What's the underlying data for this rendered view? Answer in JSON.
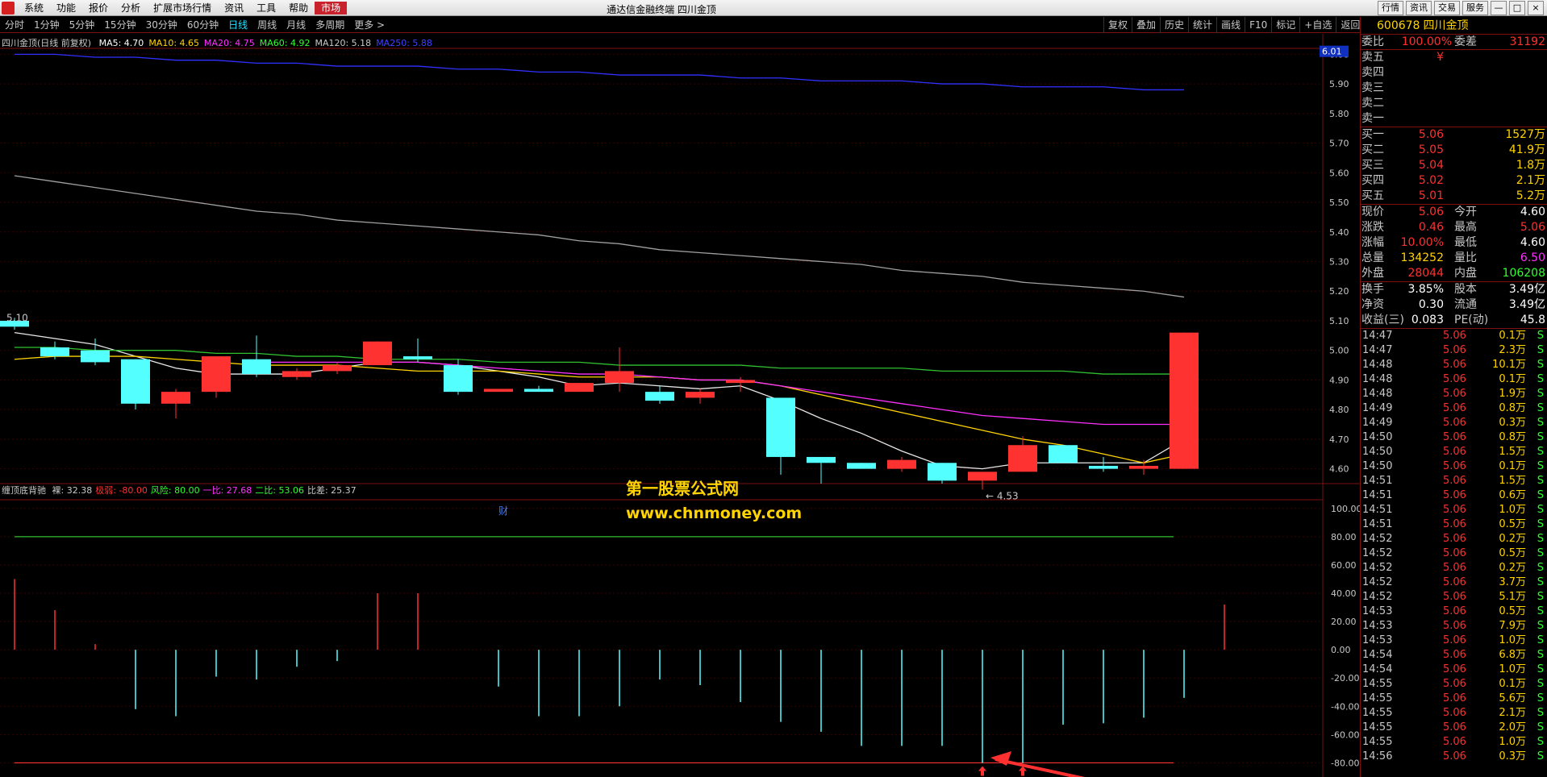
{
  "app": {
    "title": "通达信金融终端 四川金顶",
    "menus": [
      "系统",
      "功能",
      "报价",
      "分析",
      "扩展市场行情",
      "资讯",
      "工具",
      "帮助",
      "市场"
    ],
    "active_menu": "市场",
    "window_buttons": [
      "行情",
      "资讯",
      "交易",
      "服务"
    ]
  },
  "period_tabs": [
    "分时",
    "1分钟",
    "5分钟",
    "15分钟",
    "30分钟",
    "60分钟",
    "日线",
    "周线",
    "月线",
    "多周期",
    "更多 >"
  ],
  "active_period": "日线",
  "right_tools": [
    "复权",
    "叠加",
    "历史",
    "统计",
    "画线",
    "F10",
    "标记",
    "+自选",
    "返回"
  ],
  "info": {
    "stock": "四川金顶(日线 前复权)",
    "ma": [
      {
        "label": "MA5: 4.70",
        "color": "#ffffff"
      },
      {
        "label": "MA10: 4.65",
        "color": "#ffd400"
      },
      {
        "label": "MA20: 4.75",
        "color": "#ff30ff"
      },
      {
        "label": "MA60: 4.92",
        "color": "#30ff30"
      },
      {
        "label": "MA120: 5.18",
        "color": "#c8c8c8"
      },
      {
        "label": "MA250: 5.88",
        "color": "#4040ff"
      }
    ]
  },
  "chart_data": {
    "type": "candlestick",
    "price_axis": {
      "ticks": [
        "6.00",
        "5.90",
        "5.80",
        "5.70",
        "5.60",
        "5.50",
        "5.40",
        "5.30",
        "5.20",
        "5.10",
        "5.00",
        "4.90",
        "4.80",
        "4.70",
        "4.60"
      ],
      "min": 4.55,
      "max": 6.02,
      "current_label": "6.01"
    },
    "candles": [
      {
        "o": 5.1,
        "h": 5.11,
        "l": 5.07,
        "c": 5.08
      },
      {
        "o": 5.01,
        "h": 5.03,
        "l": 4.97,
        "c": 4.98
      },
      {
        "o": 5.0,
        "h": 5.04,
        "l": 4.95,
        "c": 4.96
      },
      {
        "o": 4.97,
        "h": 4.97,
        "l": 4.8,
        "c": 4.82
      },
      {
        "o": 4.82,
        "h": 4.87,
        "l": 4.77,
        "c": 4.86
      },
      {
        "o": 4.86,
        "h": 4.98,
        "l": 4.84,
        "c": 4.98
      },
      {
        "o": 4.97,
        "h": 5.05,
        "l": 4.91,
        "c": 4.92
      },
      {
        "o": 4.91,
        "h": 4.94,
        "l": 4.9,
        "c": 4.93
      },
      {
        "o": 4.93,
        "h": 4.96,
        "l": 4.92,
        "c": 4.95
      },
      {
        "o": 4.95,
        "h": 5.03,
        "l": 4.95,
        "c": 5.03
      },
      {
        "o": 4.98,
        "h": 5.04,
        "l": 4.96,
        "c": 4.97
      },
      {
        "o": 4.95,
        "h": 4.97,
        "l": 4.85,
        "c": 4.86
      },
      {
        "o": 4.86,
        "h": 4.86,
        "l": 4.86,
        "c": 4.87
      },
      {
        "o": 4.87,
        "h": 4.88,
        "l": 4.86,
        "c": 4.86
      },
      {
        "o": 4.86,
        "h": 4.89,
        "l": 4.86,
        "c": 4.89
      },
      {
        "o": 4.89,
        "h": 5.01,
        "l": 4.86,
        "c": 4.93
      },
      {
        "o": 4.86,
        "h": 4.88,
        "l": 4.82,
        "c": 4.83
      },
      {
        "o": 4.84,
        "h": 4.87,
        "l": 4.82,
        "c": 4.86
      },
      {
        "o": 4.89,
        "h": 4.91,
        "l": 4.86,
        "c": 4.9
      },
      {
        "o": 4.84,
        "h": 4.84,
        "l": 4.58,
        "c": 4.64
      },
      {
        "o": 4.64,
        "h": 4.64,
        "l": 4.55,
        "c": 4.62
      },
      {
        "o": 4.62,
        "h": 4.62,
        "l": 4.6,
        "c": 4.6
      },
      {
        "o": 4.6,
        "h": 4.64,
        "l": 4.59,
        "c": 4.63
      },
      {
        "o": 4.62,
        "h": 4.62,
        "l": 4.55,
        "c": 4.56
      },
      {
        "o": 4.56,
        "h": 4.58,
        "l": 4.53,
        "c": 4.59
      },
      {
        "o": 4.59,
        "h": 4.71,
        "l": 4.59,
        "c": 4.68
      },
      {
        "o": 4.68,
        "h": 4.68,
        "l": 4.62,
        "c": 4.62
      },
      {
        "o": 4.61,
        "h": 4.64,
        "l": 4.59,
        "c": 4.6
      },
      {
        "o": 4.6,
        "h": 4.63,
        "l": 4.58,
        "c": 4.61
      },
      {
        "o": 4.6,
        "h": 5.06,
        "l": 4.6,
        "c": 5.06
      }
    ],
    "ma_lines": [
      {
        "name": "MA5",
        "color": "#e8e8e8",
        "values": [
          5.06,
          5.04,
          5.02,
          4.98,
          4.94,
          4.92,
          4.92,
          4.92,
          4.94,
          4.96,
          4.96,
          4.95,
          4.93,
          4.91,
          4.88,
          4.89,
          4.88,
          4.87,
          4.88,
          4.83,
          4.77,
          4.72,
          4.66,
          4.61,
          4.6,
          4.62,
          4.62,
          4.62,
          4.62,
          4.7
        ]
      },
      {
        "name": "MA10",
        "color": "#ffd400",
        "values": [
          4.97,
          4.98,
          4.98,
          4.98,
          4.97,
          4.96,
          4.95,
          4.95,
          4.95,
          4.94,
          4.93,
          4.93,
          4.93,
          4.92,
          4.91,
          4.91,
          4.91,
          4.9,
          4.9,
          4.88,
          4.85,
          4.82,
          4.79,
          4.76,
          4.73,
          4.7,
          4.68,
          4.65,
          4.62,
          4.65
        ]
      },
      {
        "name": "MA20",
        "color": "#ff30ff",
        "values": [
          null,
          null,
          null,
          null,
          null,
          null,
          4.96,
          4.96,
          4.96,
          4.96,
          4.96,
          4.95,
          4.94,
          4.93,
          4.92,
          4.92,
          4.91,
          4.9,
          4.9,
          4.88,
          4.86,
          4.84,
          4.82,
          4.8,
          4.78,
          4.77,
          4.76,
          4.75,
          4.75,
          4.75
        ]
      },
      {
        "name": "MA60",
        "color": "#30c030",
        "values": [
          5.01,
          5.01,
          5.0,
          5.0,
          5.0,
          4.99,
          4.99,
          4.98,
          4.98,
          4.97,
          4.97,
          4.97,
          4.96,
          4.96,
          4.96,
          4.95,
          4.95,
          4.95,
          4.95,
          4.94,
          4.94,
          4.94,
          4.94,
          4.93,
          4.93,
          4.93,
          4.93,
          4.92,
          4.92,
          4.92
        ]
      },
      {
        "name": "MA120",
        "color": "#a0a0a0",
        "values": [
          5.59,
          5.57,
          5.55,
          5.53,
          5.51,
          5.49,
          5.47,
          5.46,
          5.44,
          5.43,
          5.42,
          5.41,
          5.4,
          5.39,
          5.37,
          5.36,
          5.34,
          5.33,
          5.32,
          5.31,
          5.3,
          5.29,
          5.27,
          5.26,
          5.25,
          5.23,
          5.22,
          5.21,
          5.2,
          5.18
        ]
      },
      {
        "name": "MA250",
        "color": "#3030ff",
        "values": [
          6.0,
          6.0,
          5.99,
          5.99,
          5.98,
          5.98,
          5.97,
          5.97,
          5.96,
          5.96,
          5.96,
          5.95,
          5.95,
          5.94,
          5.94,
          5.93,
          5.93,
          5.93,
          5.92,
          5.92,
          5.91,
          5.91,
          5.91,
          5.9,
          5.9,
          5.89,
          5.89,
          5.89,
          5.88,
          5.88
        ]
      }
    ],
    "annotations": [
      {
        "text": "5.10",
        "candle": 0
      },
      {
        "text": "← 4.53",
        "candle": 24
      },
      {
        "text": "财",
        "candle": 12
      }
    ],
    "indicator": {
      "name": "缠顶底背驰",
      "params": [
        {
          "label": "裸: 32.38",
          "color": "#c8c8c8"
        },
        {
          "label": "极弱: -80.00",
          "color": "#ff3030"
        },
        {
          "label": "风险: 80.00",
          "color": "#30ff30"
        },
        {
          "label": "一比: 27.68",
          "color": "#ff30ff"
        },
        {
          "label": "二比: 53.06",
          "color": "#30ff30"
        },
        {
          "label": "比差: 25.37",
          "color": "#c8c8c8"
        }
      ],
      "axis": {
        "ticks": [
          "100.00",
          "80.00",
          "60.00",
          "40.00",
          "20.00",
          "0.00",
          "-20.00",
          "-40.00",
          "-60.00",
          "-80.00"
        ],
        "min": -90,
        "max": 105
      },
      "values": [
        50,
        28,
        4,
        -42,
        -47,
        -19,
        -21,
        -12,
        -8,
        40,
        40,
        0,
        -26,
        -47,
        -47,
        -40,
        -21,
        -25,
        -37,
        -51,
        -58,
        -68,
        -68,
        -68,
        -80,
        -80,
        -53,
        -52,
        -48,
        -34,
        32
      ]
    }
  },
  "watermark": {
    "line1": "第一股票公式网",
    "line2": "www.chnmoney.com"
  },
  "quote": {
    "code": "600678",
    "name": "四川金顶",
    "wb": {
      "label": "委比",
      "value": "100.00%",
      "label2": "委差",
      "value2": "31192"
    },
    "sell": [
      {
        "label": "卖五",
        "p": "¥",
        "v": ""
      },
      {
        "label": "卖四",
        "p": "",
        "v": ""
      },
      {
        "label": "卖三",
        "p": "",
        "v": ""
      },
      {
        "label": "卖二",
        "p": "",
        "v": ""
      },
      {
        "label": "卖一",
        "p": "",
        "v": ""
      }
    ],
    "buy": [
      {
        "label": "买一",
        "p": "5.06",
        "v": "1527万"
      },
      {
        "label": "买二",
        "p": "5.05",
        "v": "41.9万"
      },
      {
        "label": "买三",
        "p": "5.04",
        "v": "1.8万"
      },
      {
        "label": "买四",
        "p": "5.02",
        "v": "2.1万"
      },
      {
        "label": "买五",
        "p": "5.01",
        "v": "5.2万"
      }
    ],
    "stats": [
      {
        "a": "现价",
        "b": "5.06",
        "c": "今开",
        "d": "4.60",
        "dc": "#ffffff"
      },
      {
        "a": "涨跌",
        "b": "0.46",
        "c": "最高",
        "d": "5.06",
        "dc": "#ff3030"
      },
      {
        "a": "涨幅",
        "b": "10.00%",
        "c": "最低",
        "d": "4.60",
        "dc": "#ffffff"
      },
      {
        "a": "总量",
        "b": "134252",
        "bc": "#ffd400",
        "c": "量比",
        "d": "6.50",
        "dc": "#ff30ff"
      },
      {
        "a": "外盘",
        "b": "28044",
        "c": "内盘",
        "d": "106208",
        "dc": "#30ff30"
      }
    ],
    "stats2": [
      {
        "a": "换手",
        "b": "3.85%",
        "c": "股本",
        "d": "3.49亿"
      },
      {
        "a": "净资",
        "b": "0.30",
        "c": "流通",
        "d": "3.49亿"
      },
      {
        "a": "收益(三)",
        "b": "0.083",
        "c": "PE(动)",
        "d": "45.8"
      }
    ],
    "ticks": [
      {
        "t": "14:47",
        "p": "5.06",
        "v": "0.1万",
        "s": "S"
      },
      {
        "t": "14:47",
        "p": "5.06",
        "v": "2.3万",
        "s": "S"
      },
      {
        "t": "14:48",
        "p": "5.06",
        "v": "10.1万",
        "s": "S"
      },
      {
        "t": "14:48",
        "p": "5.06",
        "v": "0.1万",
        "s": "S"
      },
      {
        "t": "14:48",
        "p": "5.06",
        "v": "1.9万",
        "s": "S"
      },
      {
        "t": "14:49",
        "p": "5.06",
        "v": "0.8万",
        "s": "S"
      },
      {
        "t": "14:49",
        "p": "5.06",
        "v": "0.3万",
        "s": "S"
      },
      {
        "t": "14:50",
        "p": "5.06",
        "v": "0.8万",
        "s": "S"
      },
      {
        "t": "14:50",
        "p": "5.06",
        "v": "1.5万",
        "s": "S"
      },
      {
        "t": "14:50",
        "p": "5.06",
        "v": "0.1万",
        "s": "S"
      },
      {
        "t": "14:51",
        "p": "5.06",
        "v": "1.5万",
        "s": "S"
      },
      {
        "t": "14:51",
        "p": "5.06",
        "v": "0.6万",
        "s": "S"
      },
      {
        "t": "14:51",
        "p": "5.06",
        "v": "1.0万",
        "s": "S"
      },
      {
        "t": "14:51",
        "p": "5.06",
        "v": "0.5万",
        "s": "S"
      },
      {
        "t": "14:52",
        "p": "5.06",
        "v": "0.2万",
        "s": "S"
      },
      {
        "t": "14:52",
        "p": "5.06",
        "v": "0.5万",
        "s": "S"
      },
      {
        "t": "14:52",
        "p": "5.06",
        "v": "0.2万",
        "s": "S"
      },
      {
        "t": "14:52",
        "p": "5.06",
        "v": "3.7万",
        "s": "S"
      },
      {
        "t": "14:52",
        "p": "5.06",
        "v": "5.1万",
        "s": "S"
      },
      {
        "t": "14:53",
        "p": "5.06",
        "v": "0.5万",
        "s": "S"
      },
      {
        "t": "14:53",
        "p": "5.06",
        "v": "7.9万",
        "s": "S"
      },
      {
        "t": "14:53",
        "p": "5.06",
        "v": "1.0万",
        "s": "S"
      },
      {
        "t": "14:54",
        "p": "5.06",
        "v": "6.8万",
        "s": "S"
      },
      {
        "t": "14:54",
        "p": "5.06",
        "v": "1.0万",
        "s": "S"
      },
      {
        "t": "14:55",
        "p": "5.06",
        "v": "0.1万",
        "s": "S"
      },
      {
        "t": "14:55",
        "p": "5.06",
        "v": "5.6万",
        "s": "S"
      },
      {
        "t": "14:55",
        "p": "5.06",
        "v": "2.1万",
        "s": "S"
      },
      {
        "t": "14:55",
        "p": "5.06",
        "v": "2.0万",
        "s": "S"
      },
      {
        "t": "14:55",
        "p": "5.06",
        "v": "1.0万",
        "s": "S"
      },
      {
        "t": "14:56",
        "p": "5.06",
        "v": "0.3万",
        "s": "S"
      }
    ]
  }
}
